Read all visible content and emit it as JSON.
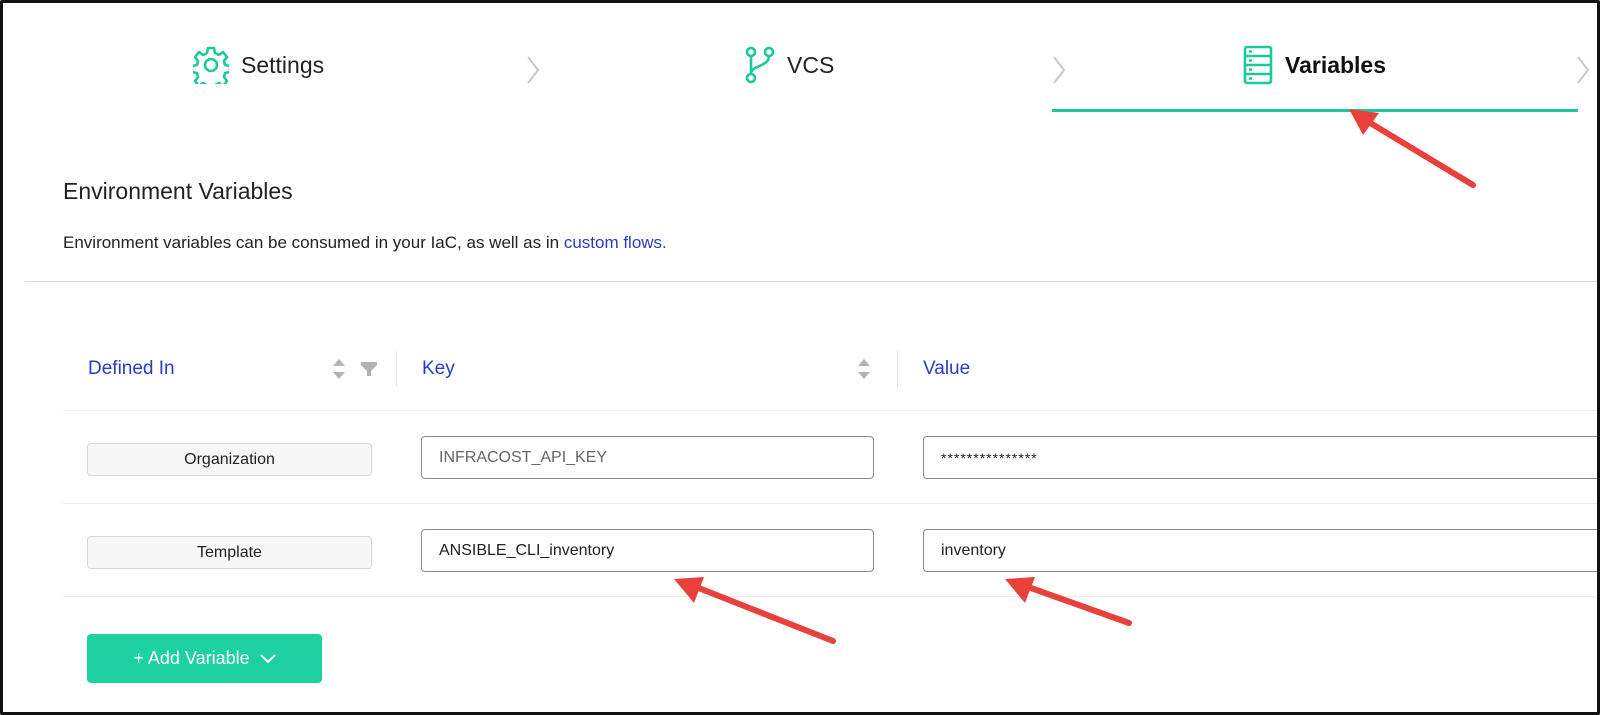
{
  "stepper": {
    "steps": [
      {
        "label": "Settings",
        "icon": "gear-icon",
        "active": false
      },
      {
        "label": "VCS",
        "icon": "branch-icon",
        "active": false
      },
      {
        "label": "Variables",
        "icon": "server-icon",
        "active": true
      }
    ],
    "accent_color": "#1dc99b"
  },
  "section": {
    "title": "Environment Variables",
    "description": "Environment variables can be consumed in your IaC, as well as in ",
    "link_text": "custom flows."
  },
  "table": {
    "columns": {
      "defined_in": "Defined In",
      "key": "Key",
      "value": "Value"
    },
    "rows": [
      {
        "defined_in": "Organization",
        "key": "INFRACOST_API_KEY",
        "value": "***************"
      },
      {
        "defined_in": "Template",
        "key": "ANSIBLE_CLI_inventory",
        "value": "inventory"
      }
    ]
  },
  "actions": {
    "add_variable_label": "+ Add Variable"
  },
  "colors": {
    "link": "#2b3bc7",
    "button": "#1dd1a1",
    "annotation_arrow": "#e8413c"
  }
}
